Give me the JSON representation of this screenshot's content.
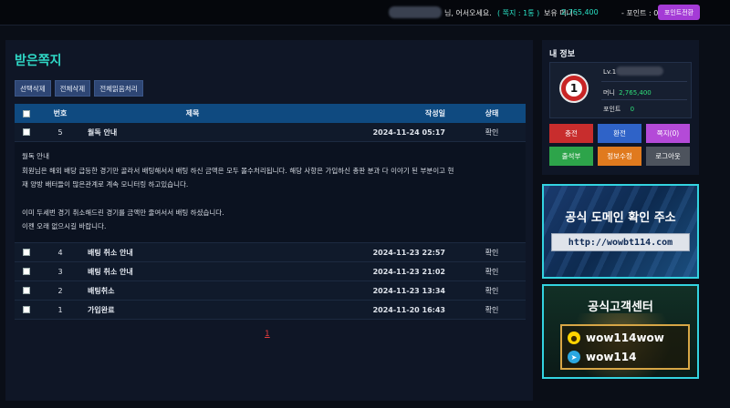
{
  "topbar": {
    "greeting": "님, 어서오세요.",
    "memo": "( 쪽지 : 1통 )",
    "money_label": "보유 머니 :",
    "money_value": "2,765,400",
    "point_label": "- 포인트 : 0",
    "point_convert_button": "포인트전환"
  },
  "page": {
    "title": "받은쪽지",
    "buttons": [
      "선택삭제",
      "전체삭제",
      "전체읽음처리"
    ]
  },
  "table": {
    "headers": {
      "num": "번호",
      "title": "제목",
      "date": "작성일",
      "status": "상태"
    },
    "first_row": {
      "num": "5",
      "title": "월독 안내",
      "date": "2024-11-24 05:17",
      "status": "확인"
    },
    "detail_lines": [
      "월독 안내",
      "회원님은 해외 배당 급등한 경기만 골라서 배팅해서서 배팅 하신 금액은 모두 몰수처리됩니다. 해당 사항은 가입하신 총판 분과 다 이야기 된 부분이고 현",
      "재 양방 배터들이 많은관계로 계속 모니터링 하고있습니다.",
      "",
      "이미 두세번 경기 취소해드린 경기를 금액만 줄여서서 배팅 하셨습니다.",
      "이젠 오래 없으시길 바랍니다."
    ],
    "rows": [
      {
        "num": "4",
        "title": "배팅 취소 안내",
        "date": "2024-11-23 22:57",
        "status": "확인"
      },
      {
        "num": "3",
        "title": "배팅 취소 안내",
        "date": "2024-11-23 21:02",
        "status": "확인"
      },
      {
        "num": "2",
        "title": "배팅취소",
        "date": "2024-11-23 13:34",
        "status": "확인"
      },
      {
        "num": "1",
        "title": "가입완료",
        "date": "2024-11-20 16:43",
        "status": "확인"
      }
    ],
    "pager": "1"
  },
  "info": {
    "title": "내 정보",
    "level": "Lv.1",
    "level_badge": "1",
    "money_label": "머니",
    "money_value": "2,765,400",
    "point_label": "포인트",
    "point_value": "0",
    "buttons": [
      "충전",
      "환전",
      "쪽지(0)",
      "출석부",
      "정보수정",
      "로그아웃"
    ]
  },
  "banners": {
    "domain_title": "공식 도메인 확인 주소",
    "domain_url": "http://wowbt114.com",
    "support_title": "공식고객센터",
    "kakao_id": "wow114wow",
    "telegram_id": "wow114"
  },
  "colors": {
    "accent_teal": "#2fd9c7",
    "header_blue": "#0f4a80",
    "point_purple": "#a43bd6",
    "banner_border": "#33d3e0"
  }
}
